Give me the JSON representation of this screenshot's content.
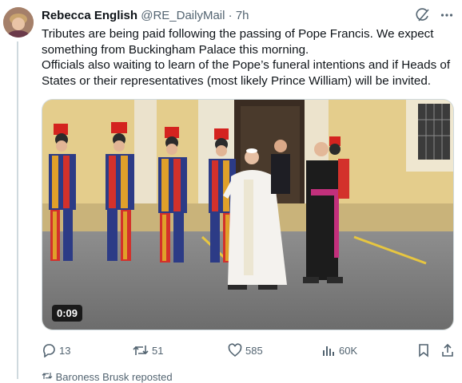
{
  "tweet": {
    "author_name": "Rebecca English",
    "handle": "@RE_DailyMail",
    "separator": "·",
    "time": "7h",
    "paragraph1": "Tributes are being paid following the passing of Pope Francis. We expect something from Buckingham Palace this morning.",
    "paragraph2": "Officials also waiting to learn of the Pope’s funeral intentions and if Heads of States or their representatives (most likely Prince William) will  be invited.",
    "media": {
      "duration": "0:09"
    }
  },
  "actions": {
    "replies": "13",
    "reposts": "51",
    "likes": "585",
    "views": "60K"
  },
  "footer": {
    "text": "Baroness Brusk reposted"
  },
  "colors": {
    "text": "#0f1419",
    "muted": "#536471",
    "border": "#cfd9de"
  }
}
